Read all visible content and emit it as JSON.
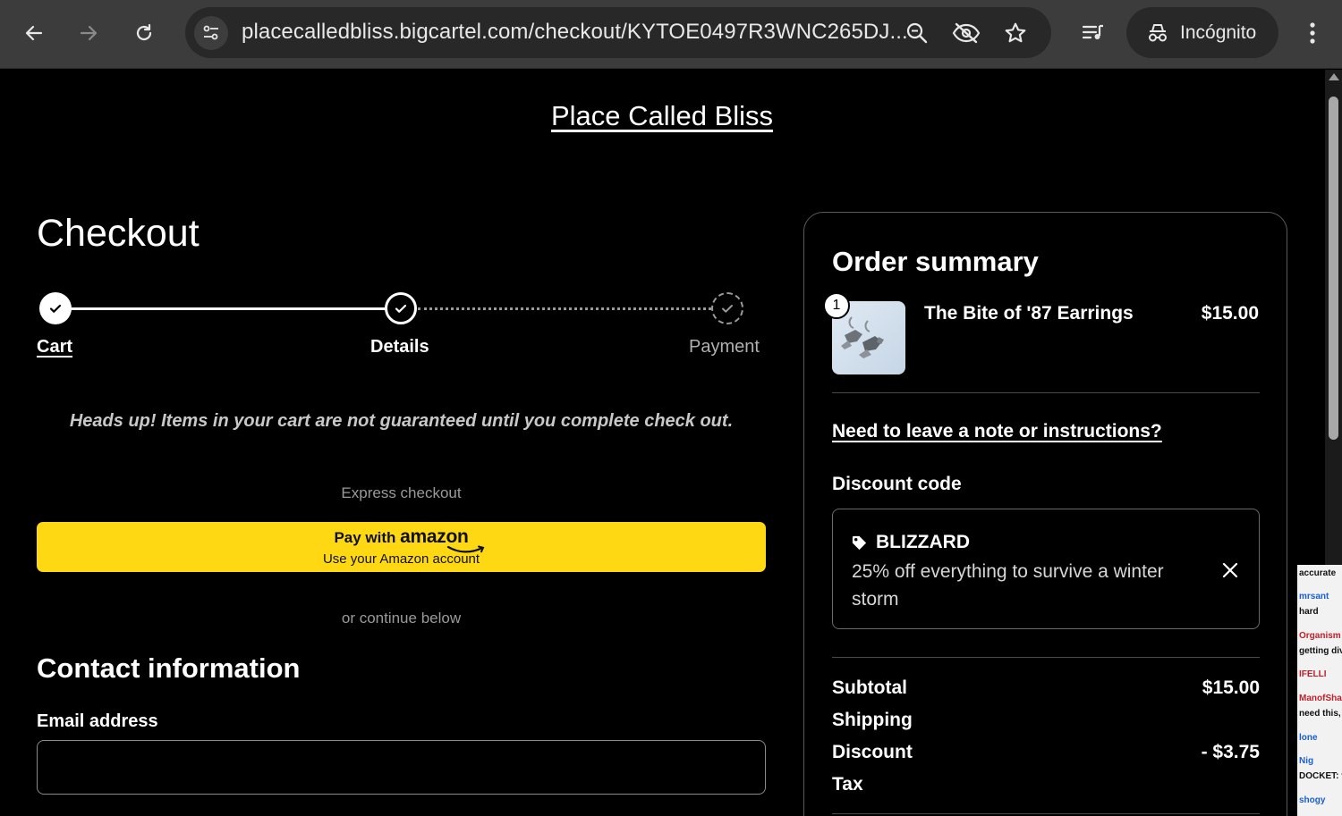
{
  "browser": {
    "url": "placecalledbliss.bigcartel.com/checkout/KYTOE0497R3WNC265DJ...",
    "incognito_label": "Incógnito"
  },
  "store": {
    "name": "Place Called Bliss"
  },
  "checkout": {
    "title": "Checkout",
    "steps": [
      {
        "label": "Cart",
        "state": "done"
      },
      {
        "label": "Details",
        "state": "current"
      },
      {
        "label": "Payment",
        "state": "pending"
      }
    ],
    "heads_up": "Heads up! Items in your cart are not guaranteed until you complete check out.",
    "express_label": "Express checkout",
    "amazon": {
      "pay_with": "Pay with",
      "brand": "amazon",
      "sub": "Use your Amazon account"
    },
    "or_continue": "or continue below",
    "contact_title": "Contact information",
    "email_label": "Email address",
    "email_value": ""
  },
  "summary": {
    "title": "Order summary",
    "item": {
      "quantity": "1",
      "name": "The Bite of '87 Earrings",
      "price": "$15.00"
    },
    "note_link": "Need to leave a note or instructions?",
    "discount_label": "Discount code",
    "discount": {
      "code": "BLIZZARD",
      "description": "25% off everything to survive a winter storm"
    },
    "totals": [
      {
        "label": "Subtotal",
        "value": "$15.00"
      },
      {
        "label": "Shipping",
        "value": ""
      },
      {
        "label": "Discount",
        "value": "- $3.75"
      },
      {
        "label": "Tax",
        "value": ""
      }
    ]
  },
  "side_chat": {
    "lines": [
      "accurate",
      "mrsant",
      "hard",
      "Organism",
      "getting div",
      "IFELLI",
      "ManofShap",
      "need this,",
      "lone",
      "Nig",
      "DOCKET: t",
      "shogy"
    ]
  }
}
